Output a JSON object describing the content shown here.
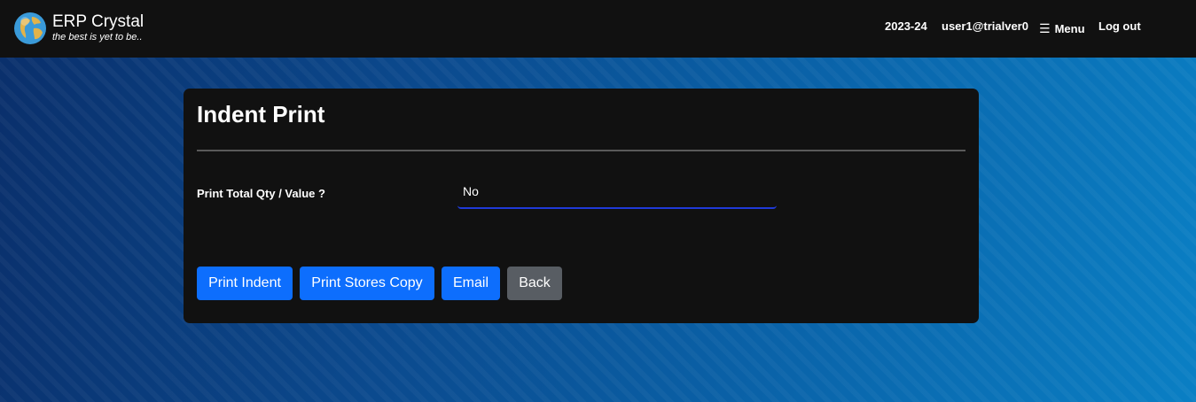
{
  "navbar": {
    "brand_name": "ERP Crystal",
    "brand_tagline": "the best is yet to be..",
    "logo_icon": "globe-icon",
    "financial_year": "2023-24",
    "user": "user1@trialver0",
    "menu_icon": "hamburger-icon",
    "menu_label": "Menu",
    "logout_label": "Log out"
  },
  "card": {
    "title": "Indent Print",
    "field_label": "Print Total Qty / Value ?",
    "field_value": "No",
    "buttons": {
      "print_indent": "Print Indent",
      "print_stores_copy": "Print Stores Copy",
      "email": "Email",
      "back": "Back"
    }
  },
  "colors": {
    "primary": "#0d6efd",
    "secondary": "#585d63",
    "card_bg": "#111111",
    "navbar_bg": "#111111",
    "select_underline": "#1f3ad8"
  }
}
